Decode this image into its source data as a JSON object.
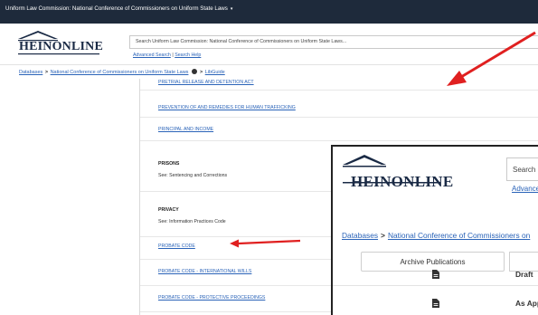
{
  "topbar": {
    "title": "Uniform Law Commission: National Conference of Commissioners on Uniform State Laws",
    "caret": "▾"
  },
  "header": {
    "logo_text": "HEINONLINE",
    "search_placeholder": "Search Uniform Law Commission: National Conference of Commissioners on Uniform State Laws...",
    "advanced_search": "Advanced Search",
    "search_help": "Search Help",
    "separator": "|"
  },
  "breadcrumb": {
    "databases": "Databases",
    "collection": "National Conference of Commissioners on Uniform State Laws",
    "libguide": "LibGuide",
    "sep": ">"
  },
  "content": {
    "items": [
      {
        "type": "link",
        "text": "PRETRIAL RELEASE AND DETENTION ACT"
      },
      {
        "type": "link",
        "text": "PREVENTION OF AND REMEDIES FOR HUMAN TRAFFICKING"
      },
      {
        "type": "link",
        "text": "PRINCIPAL AND INCOME"
      },
      {
        "type": "heading",
        "text": "PRISONS",
        "see": "See: Sentencing and Corrections"
      },
      {
        "type": "heading",
        "text": "PRIVACY",
        "see": "See: Information Practices Code"
      },
      {
        "type": "link",
        "text": "PROBATE CODE"
      },
      {
        "type": "link",
        "text": "PROBATE CODE - INTERNATIONAL WILLS"
      },
      {
        "type": "link",
        "text": "PROBATE CODE - PROTECTIVE PROCEEDINGS"
      }
    ]
  },
  "inset": {
    "logo_text": "HEINONLINE",
    "search_label": "Search",
    "advance_link": "Advance",
    "bc_databases": "Databases",
    "bc_collection": "National Conference of Commissioners on",
    "bc_sep": ">",
    "tab_archive": "Archive Publications",
    "rows": [
      {
        "label": "Draft"
      },
      {
        "label": "As App"
      }
    ]
  },
  "colors": {
    "topbar": "#1e2a3b",
    "link": "#2a63b8",
    "arrow": "#e02020"
  }
}
